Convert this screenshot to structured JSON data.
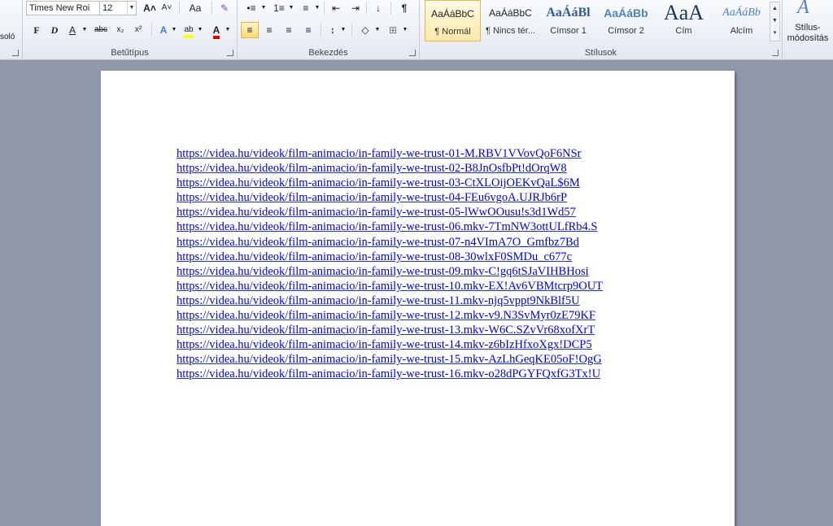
{
  "clipboard": {
    "cut_label": "soló"
  },
  "font_group": {
    "label": "Betűtípus",
    "font_name": "Times New Roi",
    "font_size": "12",
    "grow": "A˄",
    "shrink": "A˅",
    "change_case": "Aa",
    "clear_format": "✎",
    "bold": "F",
    "italic": "D",
    "underline": "A",
    "strike": "abc",
    "subscript": "x₂",
    "superscript": "x²",
    "text_effects": "A",
    "highlight": "ab",
    "font_color": "A"
  },
  "paragraph_group": {
    "label": "Bekezdés",
    "bullets": "•≡",
    "numbering": "1≡",
    "multilevel": "≡",
    "decrease_indent": "⇤",
    "increase_indent": "⇥",
    "sort": "↓",
    "show_marks": "¶",
    "align_left": "≡",
    "align_center": "≡",
    "align_right": "≡",
    "justify": "≡",
    "line_spacing": "↕",
    "shading": "◇",
    "borders": "⊞"
  },
  "styles_group": {
    "label": "Stílusok",
    "items": [
      {
        "preview": "AaÁáBbC",
        "name": "¶ Normál"
      },
      {
        "preview": "AaÁáBbC",
        "name": "¶ Nincs tér..."
      },
      {
        "preview": "AaÁáBl",
        "name": "Címsor 1"
      },
      {
        "preview": "AaÁáBb",
        "name": "Címsor 2"
      },
      {
        "preview": "AaA",
        "name": "Cím"
      },
      {
        "preview": "AaÁáBb",
        "name": "Alcím"
      }
    ],
    "change_styles": {
      "icon": "A",
      "line1": "Stílus-",
      "line2": "módosítás"
    }
  },
  "colors": {
    "highlight": "#ffff00",
    "font_color": "#e00000",
    "link": "#0000ee"
  },
  "document": {
    "links": [
      "https://videa.hu/videok/film-animacio/in-family-we-trust-01-M.RBV1VVovQoF6NSr",
      "https://videa.hu/videok/film-animacio/in-family-we-trust-02-B8JnOsfbPt!dOrqW8",
      "https://videa.hu/videok/film-animacio/in-family-we-trust-03-CtXLOijOEKvQaL$6M",
      "https://videa.hu/videok/film-animacio/in-family-we-trust-04-FEu6vgoA.UJRJb6rP",
      "https://videa.hu/videok/film-animacio/in-family-we-trust-05-lWwOOusu!s3d1Wd57",
      "https://videa.hu/videok/film-animacio/in-family-we-trust-06.mkv-7TmNW3ottULfRb4.S",
      "https://videa.hu/videok/film-animacio/in-family-we-trust-07-n4VImA7O_Gmfbz7Bd",
      "https://videa.hu/videok/film-animacio/in-family-we-trust-08-30wlxF0SMDu_c677c",
      "https://videa.hu/videok/film-animacio/in-family-we-trust-09.mkv-C!gq6tSJaVIHBHosi",
      "https://videa.hu/videok/film-animacio/in-family-we-trust-10.mkv-EX!Av6VBMtcrp9OUT",
      "https://videa.hu/videok/film-animacio/in-family-we-trust-11.mkv-njq5vppt9NkBlf5U",
      "https://videa.hu/videok/film-animacio/in-family-we-trust-12.mkv-v9.N3SvMyr0zE79KF",
      "https://videa.hu/videok/film-animacio/in-family-we-trust-13.mkv-W6C.SZvVr68xofXrT",
      "https://videa.hu/videok/film-animacio/in-family-we-trust-14.mkv-z6bIzHfxoXgx!DCP5",
      "https://videa.hu/videok/film-animacio/in-family-we-trust-15.mkv-AzLhGeqKE05oF!OgG",
      "https://videa.hu/videok/film-animacio/in-family-we-trust-16.mkv-o28dPGYFQxfG3Tx!U"
    ]
  }
}
